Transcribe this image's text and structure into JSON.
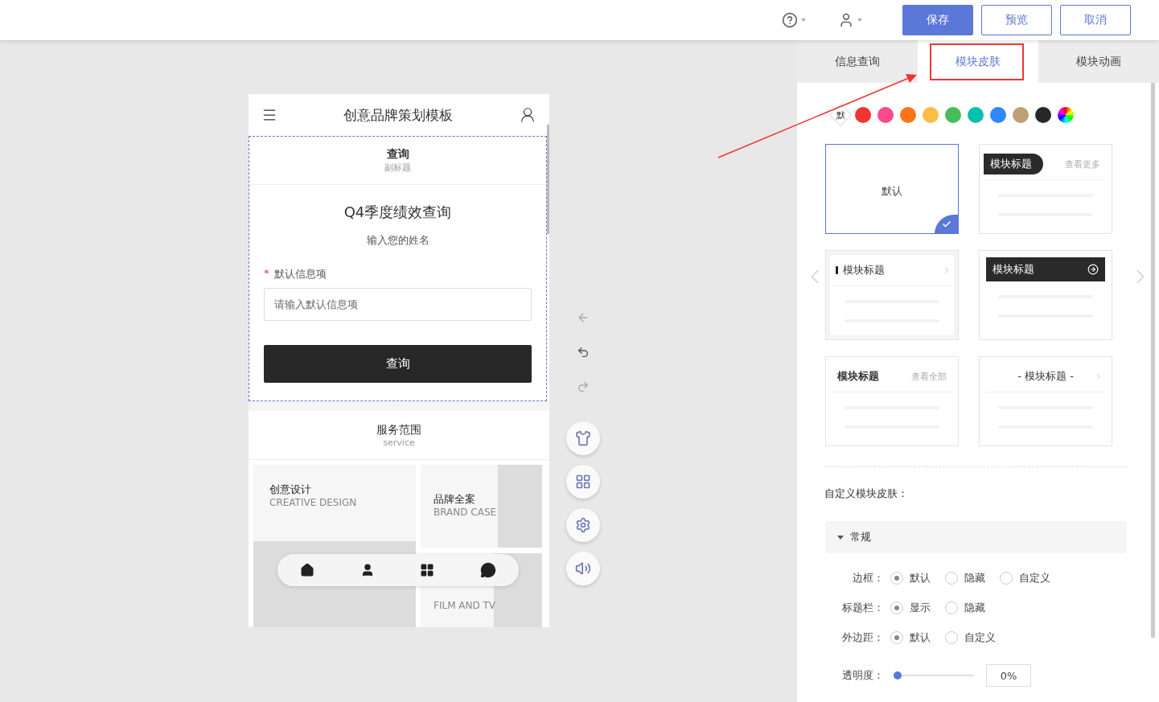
{
  "topbar": {
    "buttons": [
      {
        "label": "保存",
        "kind": "primary"
      },
      {
        "label": "预览",
        "kind": "outline"
      },
      {
        "label": "取消",
        "kind": "outline"
      }
    ]
  },
  "phone": {
    "title": "创意品牌策划模板",
    "module": {
      "title": "查询",
      "subtitle": "副标题",
      "heading": "Q4季度绩效查询",
      "prompt": "输入您的姓名",
      "field": {
        "label": "默认信息项",
        "required_mark": "*",
        "placeholder": "请输入默认信息项"
      },
      "button": "查询"
    },
    "service": {
      "title": "服务范围",
      "subtitle": "service",
      "cards": [
        {
          "title": "创意设计",
          "subtitle": "CREATIVE DESIGN"
        },
        {
          "title": "品牌全案",
          "subtitle": "BRAND CASE"
        },
        {
          "subtitle": "FILM AND TV"
        }
      ]
    }
  },
  "tabs": [
    {
      "label": "信息查询",
      "selected": false
    },
    {
      "label": "模块皮肤",
      "selected": true
    },
    {
      "label": "模块动画",
      "selected": false
    }
  ],
  "swatches": [
    {
      "kind": "default",
      "label": "默"
    },
    {
      "kind": "color",
      "color": "#f03434"
    },
    {
      "kind": "color",
      "color": "#fb4a8c"
    },
    {
      "kind": "color",
      "color": "#fd7417"
    },
    {
      "kind": "color",
      "color": "#fdbd44"
    },
    {
      "kind": "color",
      "color": "#45bd58"
    },
    {
      "kind": "color",
      "color": "#06c0ad"
    },
    {
      "kind": "color",
      "color": "#2f88fd"
    },
    {
      "kind": "color",
      "color": "#bea077"
    },
    {
      "kind": "color",
      "color": "#272727"
    },
    {
      "kind": "custom"
    }
  ],
  "skins": [
    {
      "kind": "plain",
      "title": "默认",
      "selected": true
    },
    {
      "kind": "pill",
      "title": "模块标题",
      "more": "查看更多",
      "selected": false
    },
    {
      "kind": "bar-left",
      "title": "模块标题",
      "selected": false
    },
    {
      "kind": "dark-bar",
      "title": "模块标题",
      "selected": false
    },
    {
      "kind": "title-more",
      "title": "模块标题",
      "more": "查看全部",
      "selected": false
    },
    {
      "kind": "centered",
      "title": "- 模块标题 -",
      "selected": false
    }
  ],
  "custom_skin": {
    "heading": "自定义模块皮肤：",
    "section": {
      "title": "常规",
      "expanded": true,
      "rows": [
        {
          "kind": "radio",
          "label": "边框：",
          "options": [
            {
              "label": "默认",
              "selected": true
            },
            {
              "label": "隐藏",
              "selected": false
            },
            {
              "label": "自定义",
              "selected": false
            }
          ]
        },
        {
          "kind": "radio",
          "label": "标题栏：",
          "options": [
            {
              "label": "显示",
              "selected": true
            },
            {
              "label": "隐藏",
              "selected": false
            }
          ]
        },
        {
          "kind": "radio",
          "label": "外边距：",
          "options": [
            {
              "label": "默认",
              "selected": true
            },
            {
              "label": "自定义",
              "selected": false
            }
          ]
        },
        {
          "kind": "slider",
          "label": "透明度：",
          "level": 0,
          "value": "0%"
        }
      ]
    }
  }
}
